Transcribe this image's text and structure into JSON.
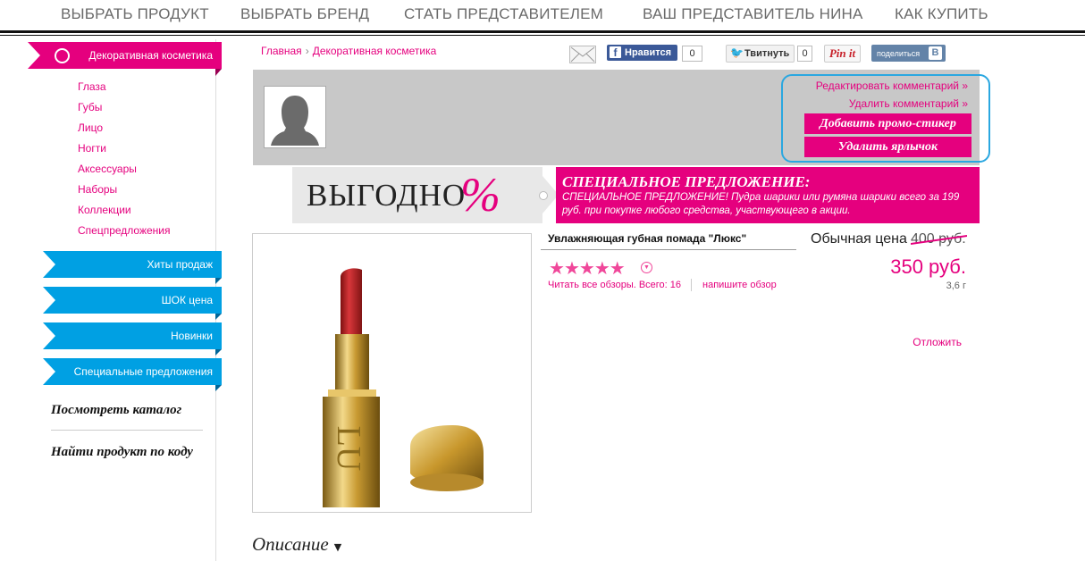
{
  "topnav": {
    "items": [
      "ВЫБРАТЬ ПРОДУКТ",
      "ВЫБРАТЬ БРЕНД",
      "СТАТЬ ПРЕДСТАВИТЕЛЕМ",
      "ВАШ ПРЕДСТАВИТЕЛЬ НИНА",
      "КАК КУПИТЬ"
    ]
  },
  "sidebar": {
    "category": "Декоративная косметика",
    "subitems": [
      "Глаза",
      "Губы",
      "Лицо",
      "Ногти",
      "Аксессуары",
      "Наборы",
      "Коллекции",
      "Спецпредложения"
    ],
    "tabs": [
      "Хиты продаж",
      "ШОК цена",
      "Новинки",
      "Специальные предложения"
    ],
    "catalog_link": "Посмотреть каталог",
    "find_code_link": "Найти продукт по коду",
    "colors": {
      "pink": "#e5007e",
      "blue": "#00a0e3"
    }
  },
  "breadcrumb": {
    "home": "Главная",
    "separator": "›",
    "current": "Декоративная косметика"
  },
  "social": {
    "mail_icon": "mail-icon",
    "facebook_label": "Нравится",
    "facebook_count": "0",
    "twitter_label": "Твитнуть",
    "twitter_count": "0",
    "pinterest_label": "Pin it",
    "vk_label": "поделиться",
    "vk_badge": "В"
  },
  "admin": {
    "edit_comment": "Редактировать комментарий »",
    "delete_comment": "Удалить комментарий »",
    "add_sticker": "Добавить промо-стикер",
    "delete_label": "Удалить ярлычок"
  },
  "promo": {
    "tag_text": "ВЫГОДНО",
    "tag_symbol": "%",
    "title": "СПЕЦИАЛЬНОЕ ПРЕДЛОЖЕНИЕ:",
    "text": "СПЕЦИАЛЬНОЕ ПРЕДЛОЖЕНИЕ! Пудра шарики или румяна шарики всего за 199 руб. при покупке любого средства, участвующего в акции."
  },
  "product": {
    "name": "Увлажняющая губная помада \"Люкс\"",
    "rating": 5,
    "rating_max": 5,
    "reviews_text": "Читать все обзоры. Всего: 16",
    "write_review": "напишите обзор",
    "regular_price_label": "Обычная цена",
    "old_price": "400 руб.",
    "new_price": "350 руб.",
    "volume": "3,6 г",
    "wishlist": "Отложить",
    "cap_letters": "LU"
  },
  "description": {
    "label": "Описание",
    "arrow": "▼"
  }
}
